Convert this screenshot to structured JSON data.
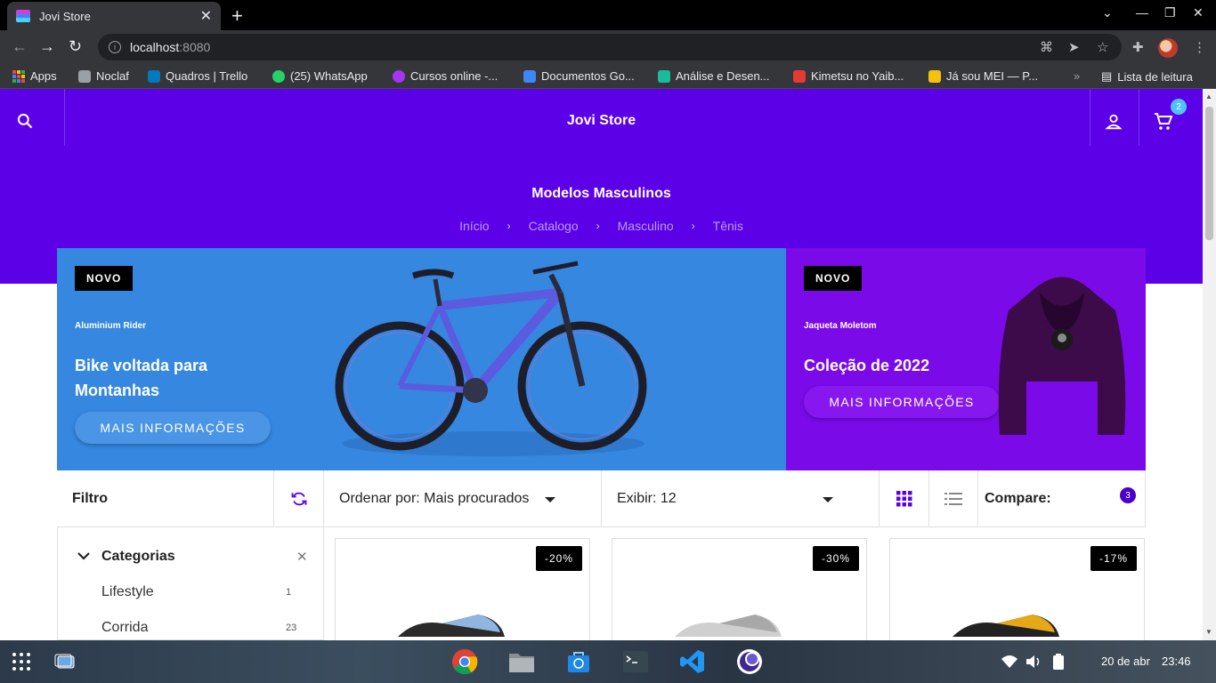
{
  "browser": {
    "tab_title": "Jovi Store",
    "url_host": "localhost",
    "url_port": ":8080"
  },
  "bookmarks": [
    {
      "label": "Apps",
      "color": "#e8453c"
    },
    {
      "label": "Noclaf",
      "color": "#9aa0a6"
    },
    {
      "label": "Quadros | Trello",
      "color": "#0079bf"
    },
    {
      "label": "(25) WhatsApp",
      "color": "#25d366"
    },
    {
      "label": "Cursos online -...",
      "color": "#a435f0"
    },
    {
      "label": "Documentos Go...",
      "color": "#4285f4"
    },
    {
      "label": "Análise e Desen...",
      "color": "#1bbc9b"
    },
    {
      "label": "Kimetsu no Yaib...",
      "color": "#e53935"
    },
    {
      "label": "Já sou MEI — P...",
      "color": "#f4c20d"
    }
  ],
  "reading_list": "Lista de leitura",
  "store": {
    "brand": "Jovi Store",
    "cart_count": "2",
    "page_title": "Modelos Masculinos",
    "breadcrumb": [
      "Início",
      "Catalogo",
      "Masculino",
      "Tênis"
    ]
  },
  "banners": [
    {
      "tag": "NOVO",
      "subtitle": "Aluminium Rider",
      "headline": "Bike voltada para Montanhas",
      "cta": "MAIS INFORMAÇÕES"
    },
    {
      "tag": "NOVO",
      "subtitle": "Jaqueta Moletom",
      "headline": "Coleção de 2022",
      "cta": "MAIS INFORMAÇÕES"
    }
  ],
  "toolbar": {
    "filter_label": "Filtro",
    "sort_label": "Ordenar por: Mais procurados",
    "show_label": "Exibir: 12",
    "compare_label": "Compare:",
    "compare_count": "3"
  },
  "categories": {
    "title": "Categorias",
    "items": [
      {
        "label": "Lifestyle",
        "count": "1"
      },
      {
        "label": "Corrida",
        "count": "23"
      }
    ]
  },
  "products": [
    {
      "discount": "-20%"
    },
    {
      "discount": "-30%"
    },
    {
      "discount": "-17%"
    }
  ],
  "taskbar": {
    "date": "20 de abr",
    "time": "23:46"
  },
  "colors": {
    "brand_purple": "#5c00e8",
    "banner_blue": "#3587e0",
    "banner_violet": "#7a0ae8"
  }
}
